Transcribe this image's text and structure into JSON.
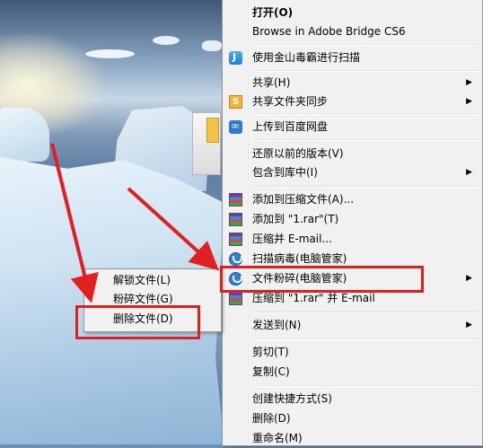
{
  "context_menu": {
    "items": [
      {
        "label": "打开(O)",
        "bold": true
      },
      {
        "label": "Browse in Adobe Bridge CS6"
      },
      {
        "label": "使用金山毒霸进行扫描",
        "icon": "bridge-icon"
      },
      {
        "label": "共享(H)",
        "submenu": true
      },
      {
        "label": "共享文件夹同步",
        "icon": "sync-icon",
        "submenu": true
      },
      {
        "label": "上传到百度网盘",
        "icon": "baidu-cloud-icon"
      },
      {
        "label": "还原以前的版本(V)"
      },
      {
        "label": "包含到库中(I)",
        "submenu": true
      },
      {
        "label": "添加到压缩文件(A)...",
        "icon": "winrar-icon"
      },
      {
        "label": "添加到 \"1.rar\"(T)",
        "icon": "winrar-icon"
      },
      {
        "label": "压缩并 E-mail...",
        "icon": "winrar-icon"
      },
      {
        "label": "扫描病毒(电脑管家)",
        "icon": "shield-icon"
      },
      {
        "label": "文件粉碎(电脑管家)",
        "icon": "shield-icon",
        "submenu": true
      },
      {
        "label": "压缩到 \"1.rar\" 并 E-mail",
        "icon": "winrar-icon"
      },
      {
        "label": "发送到(N)",
        "submenu": true
      },
      {
        "label": "剪切(T)"
      },
      {
        "label": "复制(C)"
      },
      {
        "label": "创建快捷方式(S)"
      },
      {
        "label": "删除(D)"
      },
      {
        "label": "重命名(M)"
      }
    ],
    "submenu_arrow": "▶"
  },
  "submenu": {
    "items": [
      {
        "label": "解锁文件(L)"
      },
      {
        "label": "粉碎文件(G)"
      },
      {
        "label": "删除文件(D)"
      }
    ]
  },
  "colors": {
    "highlight": "#e02020",
    "menu_bg": "#f1f1f1"
  }
}
